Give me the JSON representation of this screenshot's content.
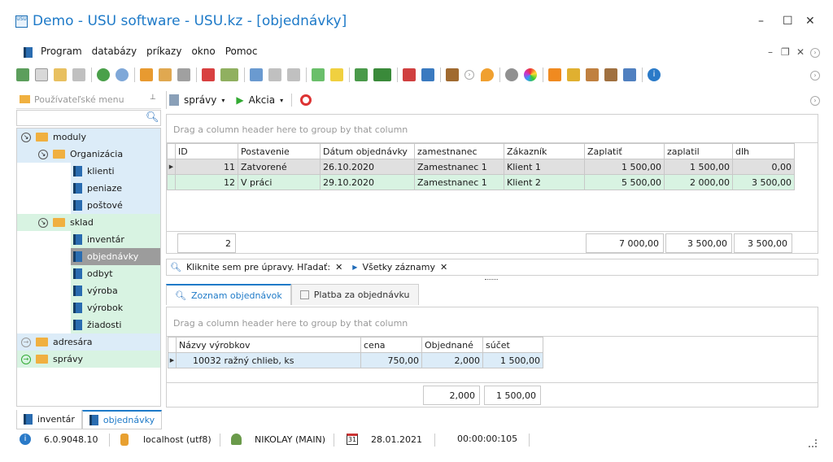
{
  "window": {
    "title": "Demo - USU software - USU.kz - [objednávky]",
    "logo_text": "USU",
    "minimize": "–",
    "maximize": "☐",
    "close": "✕"
  },
  "menu": {
    "items": [
      "Program",
      "databázy",
      "príkazy",
      "okno",
      "Pomoc"
    ],
    "mdi_min": "–",
    "mdi_restore": "❐",
    "mdi_close": "✕"
  },
  "sidebar": {
    "title": "Používateľské menu",
    "pin": "⊥",
    "nodes": [
      {
        "label": "moduly"
      },
      {
        "label": "Organizácia"
      },
      {
        "label": "klienti"
      },
      {
        "label": "peniaze"
      },
      {
        "label": "poštové"
      },
      {
        "label": "sklad"
      },
      {
        "label": "inventár"
      },
      {
        "label": "objednávky"
      },
      {
        "label": "odbyt"
      },
      {
        "label": "výroba"
      },
      {
        "label": "výrobok"
      },
      {
        "label": "žiadosti"
      },
      {
        "label": "adresára"
      },
      {
        "label": "správy"
      }
    ]
  },
  "bottom_tabs": [
    {
      "label": "inventár"
    },
    {
      "label": "objednávky"
    }
  ],
  "main_toolbar": {
    "reports": "správy",
    "actions": "Akcia"
  },
  "orders": {
    "group_hint": "Drag a column header here to group by that column",
    "columns": [
      "ID",
      "Postavenie",
      "Dátum objednávky",
      "zamestnanec",
      "Zákazník",
      "Zaplatiť",
      "zaplatil",
      "dlh"
    ],
    "rows": [
      [
        "11",
        "Zatvorené",
        "26.10.2020",
        "Zamestnanec 1",
        "Klient 1",
        "1 500,00",
        "1 500,00",
        "0,00"
      ],
      [
        "12",
        "V práci",
        "29.10.2020",
        "Zamestnanec 1",
        "Klient 2",
        "5 500,00",
        "2 000,00",
        "3 500,00"
      ]
    ],
    "footer": {
      "count": "2",
      "to_pay": "7 000,00",
      "paid": "3 500,00",
      "debt": "3 500,00"
    }
  },
  "filter": {
    "edit_text": "Kliknite sem pre úpravy. Hľadať:",
    "all_records": "Všetky záznamy",
    "clear": "✕"
  },
  "detail_tabs": [
    {
      "label": "Zoznam objednávok"
    },
    {
      "label": "Platba za objednávku"
    }
  ],
  "items": {
    "group_hint": "Drag a column header here to group by that column",
    "columns": [
      "Názvy výrobkov",
      "cena",
      "Objednané",
      "súčet"
    ],
    "rows": [
      [
        "10032 ražný chlieb, ks",
        "750,00",
        "2,000",
        "1 500,00"
      ]
    ],
    "footer": {
      "ordered": "2,000",
      "sum": "1 500,00"
    }
  },
  "status": {
    "version": "6.0.9048.10",
    "db": "localhost (utf8)",
    "user": "NIKOLAY (MAIN)",
    "date": "28.01.2021",
    "timer": "00:00:00:105",
    "cal_icon_text": "31"
  },
  "colors": {
    "accent": "#1e7ac8",
    "selected_row": "#e0e0e0",
    "row_green": "#d8f3e2",
    "tree_blue": "#dcecf8",
    "tree_green": "#d8f3e2",
    "tree_sel": "#9c9c9c"
  }
}
